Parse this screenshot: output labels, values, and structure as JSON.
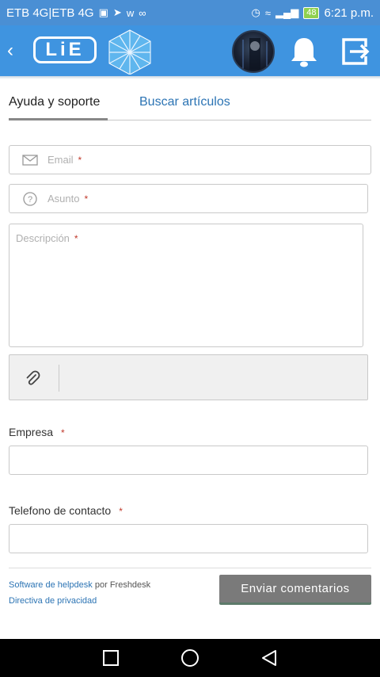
{
  "status_bar": {
    "carrier": "ETB 4G|ETB 4G",
    "battery": "48",
    "time": "6:21 p.m."
  },
  "header": {
    "logo_text": "LiE"
  },
  "tabs": [
    {
      "label": "Ayuda y soporte",
      "active": true
    },
    {
      "label": "Buscar artículos",
      "active": false
    }
  ],
  "form": {
    "email_placeholder": "Email",
    "subject_placeholder": "Asunto",
    "description_placeholder": "Descripción",
    "required_mark": "*",
    "company_label": "Empresa",
    "phone_label": "Telefono de contacto"
  },
  "footer": {
    "helpdesk_link": "Software de helpdesk",
    "by_text": "por Freshdesk",
    "privacy_link": "Directiva de privacidad",
    "submit_label": "Enviar comentarios"
  },
  "colors": {
    "header_bg": "#3f94e0",
    "link": "#2c74b4",
    "required": "#c0392b",
    "submit_bg": "#7a7a7a"
  }
}
